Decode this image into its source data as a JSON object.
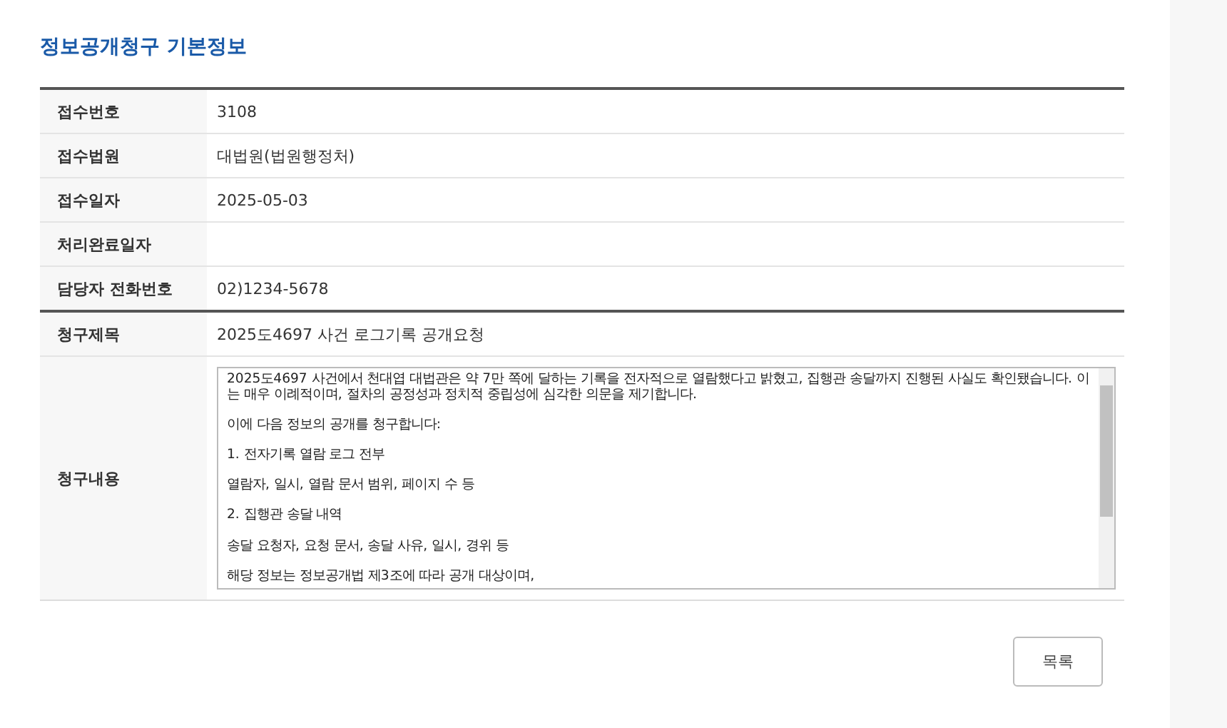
{
  "page_title": "정보공개청구 기본정보",
  "info_rows": [
    {
      "label": "접수번호",
      "value": "3108"
    },
    {
      "label": "접수법원",
      "value": "대법원(법원행정처)"
    },
    {
      "label": "접수일자",
      "value": "2025-05-03"
    },
    {
      "label": "처리완료일자",
      "value": ""
    },
    {
      "label": "담당자 전화번호",
      "value": "02)1234-5678"
    }
  ],
  "request_title": {
    "label": "청구제목",
    "value": "2025도4697 사건 로그기록 공개요청"
  },
  "request_content": {
    "label": "청구내용",
    "value": "2025도4697 사건에서 천대엽 대법관은 약 7만 쪽에 달하는 기록을 전자적으로 열람했다고 밝혔고, 집행관 송달까지 진행된 사실도 확인됐습니다. 이는 매우 이례적이며, 절차의 공정성과 정치적 중립성에 심각한 의문을 제기합니다.\n\n이에 다음 정보의 공개를 청구합니다:\n\n1. 전자기록 열람 로그 전부\n\n열람자, 일시, 열람 문서 범위, 페이지 수 등\n\n2. 집행관 송달 내역\n\n송달 요청자, 요청 문서, 송달 사유, 일시, 경위 등\n\n해당 정보는 정보공개법 제3조에 따라 공개 대상이며,"
  },
  "buttons": [
    {
      "label": "목록"
    }
  ]
}
